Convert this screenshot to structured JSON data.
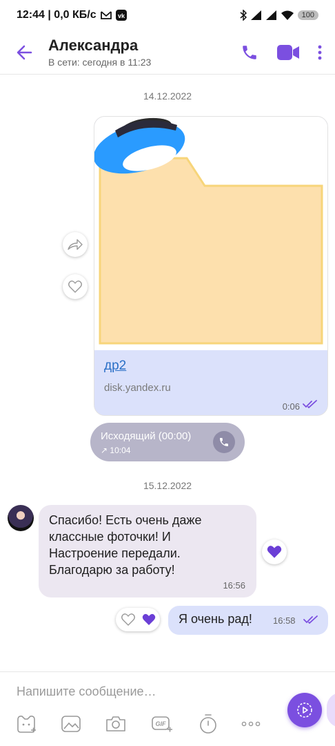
{
  "status_bar": {
    "time_speed": "12:44 | 0,0 КБ/с",
    "battery": "100",
    "icons": [
      "gmail-icon",
      "vk-icon",
      "bluetooth-icon",
      "signal-icon",
      "wifi-icon",
      "battery-icon"
    ]
  },
  "header": {
    "contact_name": "Александра",
    "contact_status": "В сети: сегодня в 11:23",
    "icons": [
      "back-arrow-icon",
      "phone-icon",
      "video-camera-icon",
      "more-vertical-icon"
    ],
    "accent_color": "#7b4fe0"
  },
  "chat": {
    "date_1": "14.12.2022",
    "link_card": {
      "title": "др2",
      "domain": "disk.yandex.ru",
      "time": "0:06",
      "image": "yandex-disk-folder-icon"
    },
    "call": {
      "title": "Исходящий (00:00)",
      "time": "↗ 10:04"
    },
    "date_2": "15.12.2022",
    "incoming": {
      "text": "Спасибо! Есть очень даже\nклассные фоточки! И\nНастроение передали.\nБлагодарю за работу!",
      "time": "16:56"
    },
    "outgoing": {
      "text": "Я очень рад!",
      "time": "16:58"
    }
  },
  "composer": {
    "placeholder": "Напишите сообщение…",
    "tools": [
      "sticker-icon",
      "gallery-icon",
      "camera-icon",
      "gif-icon",
      "timer-icon",
      "more-horizontal-icon"
    ]
  }
}
